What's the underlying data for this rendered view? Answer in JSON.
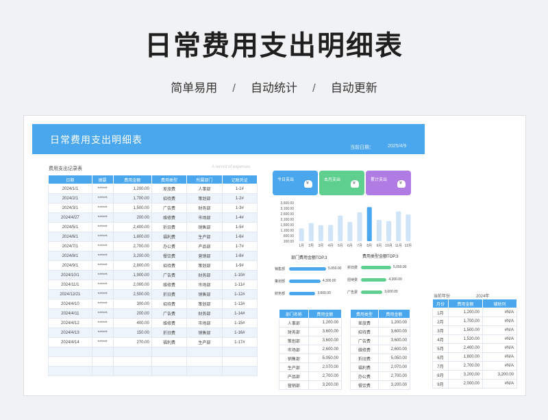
{
  "hero": {
    "title": "日常费用支出明细表",
    "features": [
      "简单易用",
      "自动统计",
      "自动更新"
    ],
    "separator": "/"
  },
  "sheet": {
    "banner_title": "日常费用支出明细表",
    "date_label": "当前日期：",
    "date_value": "2025/4/9"
  },
  "record": {
    "title": "费用支出记录表",
    "subtitle": "A record of expenses",
    "columns": [
      "日期",
      "摘要",
      "费用金额",
      "费用类型",
      "所属部门",
      "记账凭证"
    ],
    "rows": [
      [
        "2024/1/1",
        "******",
        "1,200.00",
        "差旅费",
        "人事部",
        "1-1#"
      ],
      [
        "2024/2/1",
        "******",
        "1,700.00",
        "招待费",
        "策划部",
        "1-2#"
      ],
      [
        "2024/3/1",
        "******",
        "1,500.00",
        "广告费",
        "财务部",
        "1-3#"
      ],
      [
        "2024/4/27",
        "******",
        "200.00",
        "维修费",
        "市场部",
        "1-4#"
      ],
      [
        "2024/5/1",
        "******",
        "2,400.00",
        "折旧费",
        "销售部",
        "1-5#"
      ],
      [
        "2024/6/1",
        "******",
        "1,800.00",
        "福利费",
        "生产部",
        "1-6#"
      ],
      [
        "2024/7/1",
        "******",
        "2,700.00",
        "办公费",
        "产品部",
        "1-7#"
      ],
      [
        "2024/8/1",
        "******",
        "3,200.00",
        "餐饮费",
        "营销部",
        "1-8#"
      ],
      [
        "2024/9/1",
        "******",
        "2,800.00",
        "招待费",
        "策划部",
        "1-9#"
      ],
      [
        "2024/10/1",
        "******",
        "1,900.00",
        "广告费",
        "财务部",
        "1-10#"
      ],
      [
        "2024/11/1",
        "******",
        "2,000.00",
        "维修费",
        "市场部",
        "1-11#"
      ],
      [
        "2024/12/21",
        "******",
        "2,500.00",
        "折旧费",
        "销售部",
        "1-12#"
      ],
      [
        "2024/4/10",
        "******",
        "300.00",
        "招待费",
        "策划部",
        "1-13#"
      ],
      [
        "2024/4/11",
        "******",
        "200.00",
        "广告费",
        "财务部",
        "1-14#"
      ],
      [
        "2024/4/12",
        "******",
        "400.00",
        "维修费",
        "市场部",
        "1-15#"
      ],
      [
        "2024/4/13",
        "******",
        "150.00",
        "折旧费",
        "销售部",
        "1-16#"
      ],
      [
        "2024/4/14",
        "******",
        "270.00",
        "福利费",
        "生产部",
        "1-17#"
      ],
      [
        "",
        "",
        "",
        "",
        "",
        ""
      ],
      [
        "",
        "",
        "",
        "",
        "",
        ""
      ],
      [
        "",
        "",
        "",
        "",
        "",
        ""
      ]
    ]
  },
  "kpis": [
    {
      "label": "今日支出",
      "color": "#4aa7ee"
    },
    {
      "label": "本月支出",
      "color": "#5ecf8f"
    },
    {
      "label": "累计支出",
      "color": "#b07be3"
    }
  ],
  "chart_data": {
    "type": "bar",
    "categories": [
      "1月",
      "2月",
      "3月",
      "4月",
      "5月",
      "6月",
      "7月",
      "8月",
      "9月",
      "10月",
      "11月",
      "12月"
    ],
    "values": [
      1200,
      1700,
      1500,
      1520,
      2400,
      1800,
      2700,
      3200,
      2000,
      1900,
      2800,
      2500
    ],
    "highlight_index": 7,
    "ylim": [
      0,
      3600
    ],
    "yticks": [
      "3,600.00",
      "3,100.00",
      "2,600.00",
      "2,100.00",
      "1,600.00",
      "1,100.00",
      "600.00",
      "100.00"
    ],
    "bar_color": "#cfe4f7",
    "highlight_color": "#4aa7ee"
  },
  "dept_top": {
    "title": "部门费用金额TOP.3",
    "items": [
      {
        "name": "销售部",
        "value": "5,050.00",
        "level": 1.0
      },
      {
        "name": "策划部",
        "value": "4,300.00",
        "level": 0.85
      },
      {
        "name": "财务部",
        "value": "3,600.00",
        "level": 0.71
      }
    ],
    "color": "#4aa7ee"
  },
  "type_top": {
    "title": "费用类型金额TOP.3",
    "items": [
      {
        "name": "折旧费",
        "value": "5,050.00",
        "level": 1.0
      },
      {
        "name": "招待费",
        "value": "4,300.00",
        "level": 0.85
      },
      {
        "name": "广告费",
        "value": "3,600.00",
        "level": 0.71
      }
    ],
    "color": "#5ecf8f"
  },
  "dept_table": {
    "columns": [
      "部门名称",
      "费用金额"
    ],
    "rows": [
      [
        "人事部",
        "1,200.00"
      ],
      [
        "财务部",
        "3,600.00"
      ],
      [
        "策划部",
        "3,600.00"
      ],
      [
        "市场部",
        "2,600.00"
      ],
      [
        "销售部",
        "5,050.00"
      ],
      [
        "生产部",
        "2,070.00"
      ],
      [
        "产品部",
        "2,700.00"
      ],
      [
        "营销部",
        "3,200.00"
      ]
    ]
  },
  "type_table": {
    "columns": [
      "费用类型",
      "费用金额"
    ],
    "rows": [
      [
        "差旅费",
        "1,200.00"
      ],
      [
        "招待费",
        "3,600.00"
      ],
      [
        "广告费",
        "3,600.00"
      ],
      [
        "维修费",
        "2,600.00"
      ],
      [
        "折旧费",
        "5,050.00"
      ],
      [
        "福利费",
        "2,070.00"
      ],
      [
        "办公费",
        "2,700.00"
      ],
      [
        "餐饮费",
        "3,200.00"
      ]
    ]
  },
  "month_table": {
    "year_label": "当前年份",
    "year_value": "2024年",
    "columns": [
      "月份",
      "费用金额",
      "辅助列"
    ],
    "rows": [
      [
        "1月",
        "1,200.00",
        "#N/A"
      ],
      [
        "2月",
        "1,700.00",
        "#N/A"
      ],
      [
        "3月",
        "1,500.00",
        "#N/A"
      ],
      [
        "4月",
        "1,520.00",
        "#N/A"
      ],
      [
        "5月",
        "2,400.00",
        "#N/A"
      ],
      [
        "6月",
        "1,800.00",
        "#N/A"
      ],
      [
        "7月",
        "2,700.00",
        "#N/A"
      ],
      [
        "8月",
        "3,200.00",
        "3,200.00"
      ],
      [
        "9月",
        "2,000.00",
        "#N/A"
      ]
    ]
  }
}
